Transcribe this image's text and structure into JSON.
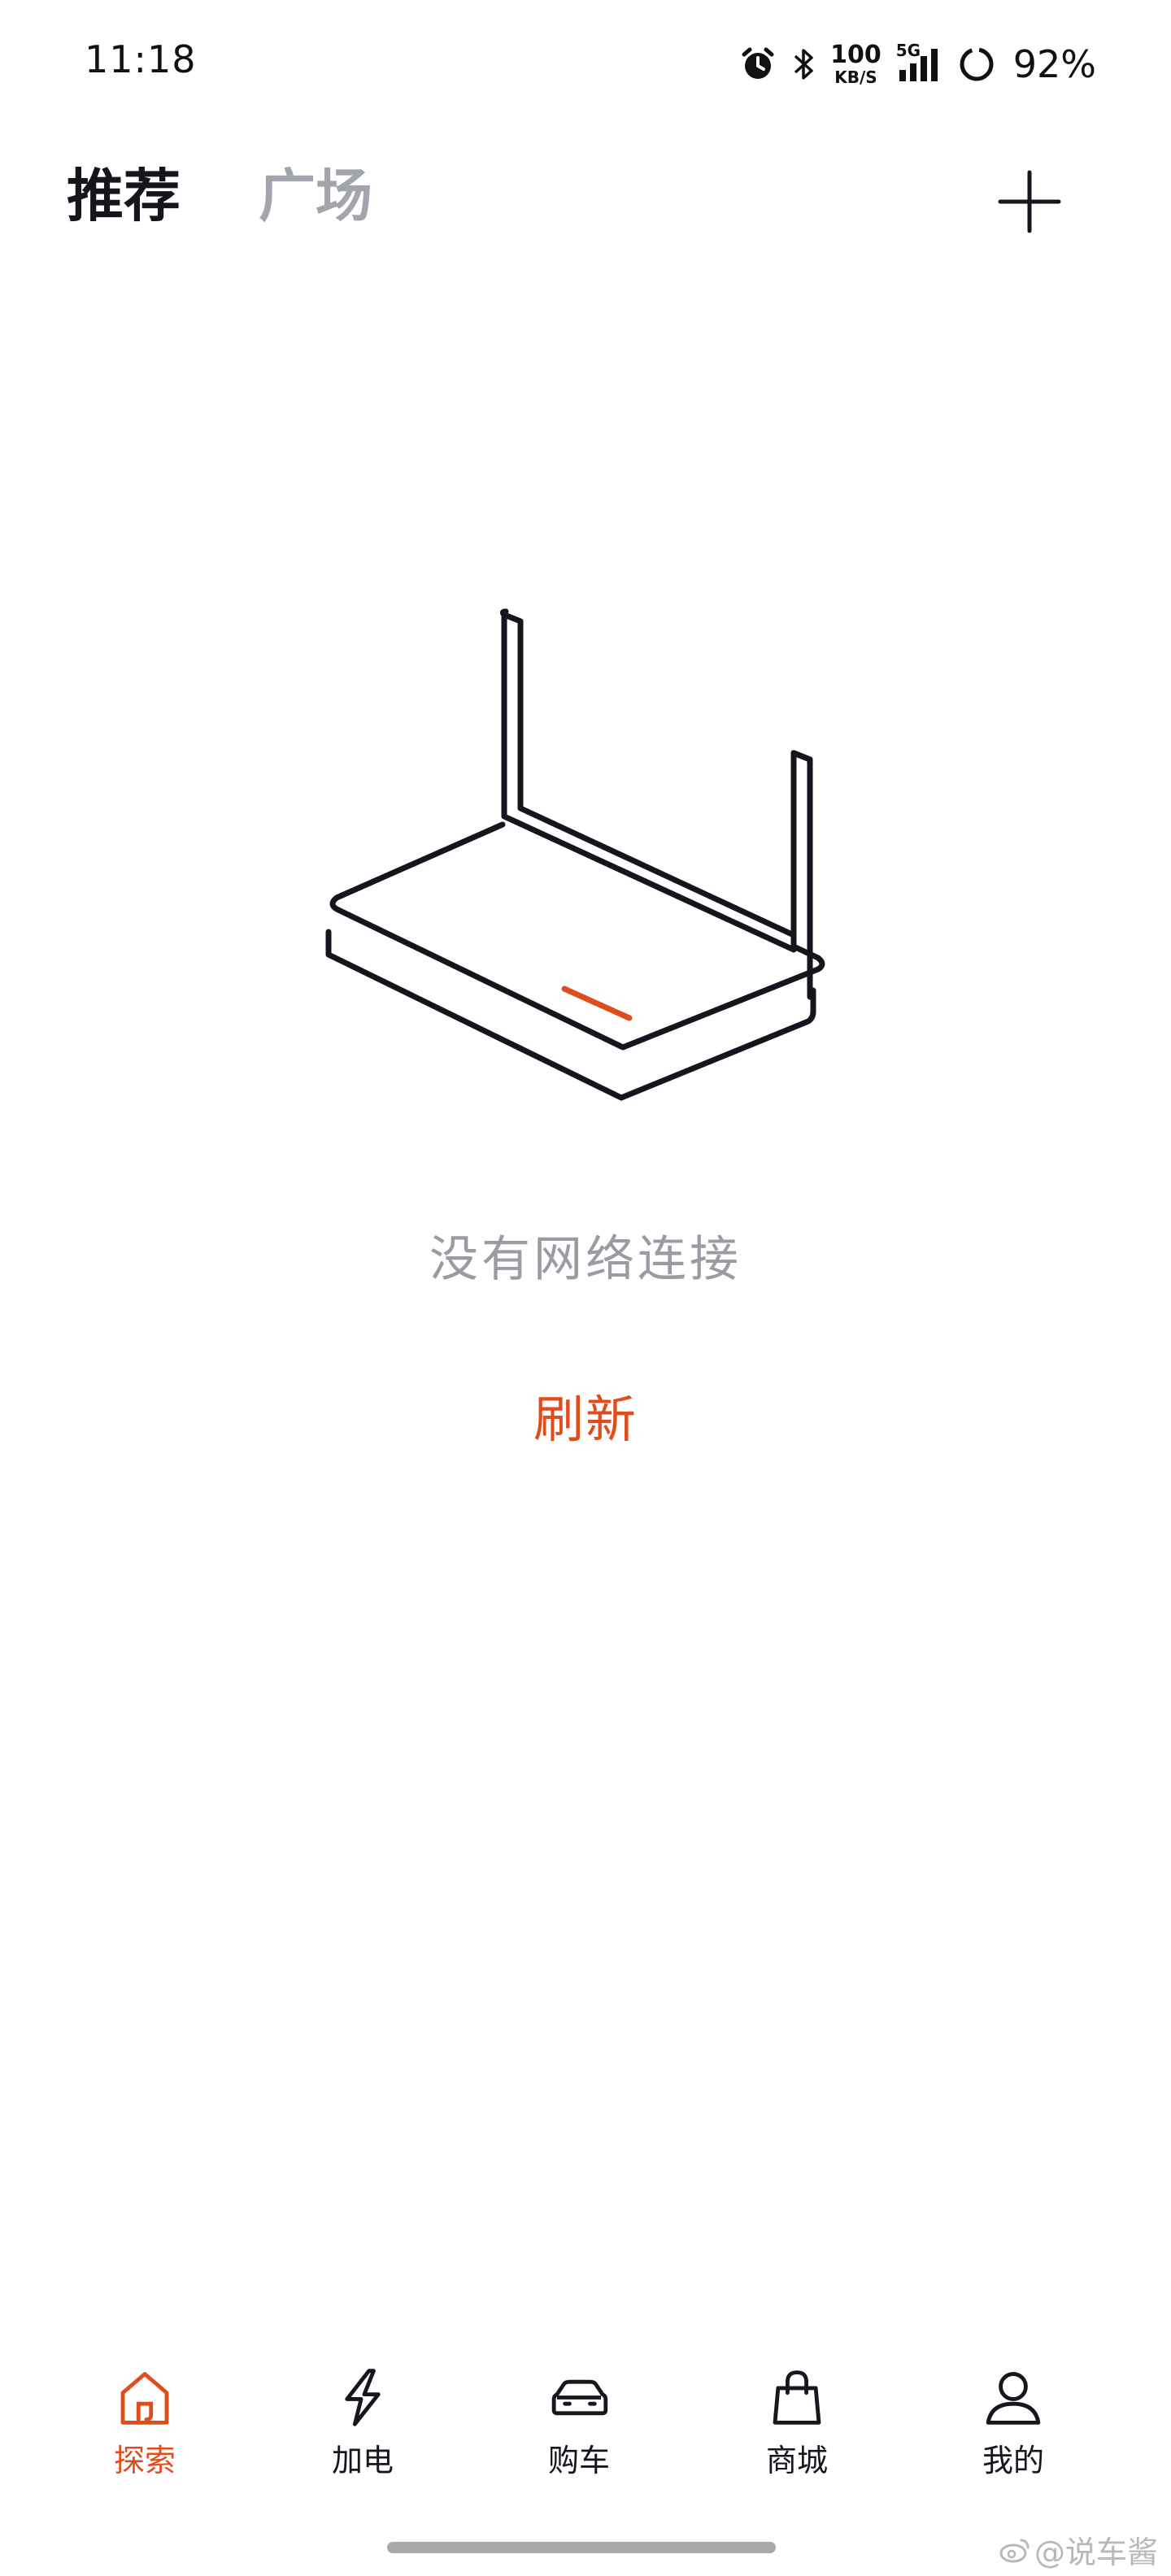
{
  "status_bar": {
    "time": "11:18",
    "net_speed_value": "100",
    "net_speed_unit": "KB/S",
    "signal_label": "5G",
    "battery_percent": "92%",
    "icons": [
      "alarm-icon",
      "bluetooth-icon",
      "signal-icon",
      "battery-ring-icon"
    ]
  },
  "header": {
    "tabs": [
      {
        "label": "推荐",
        "active": true
      },
      {
        "label": "广场",
        "active": false
      }
    ],
    "add_icon": "plus-icon"
  },
  "empty_state": {
    "illustration": "router-icon",
    "message": "没有网络连接",
    "refresh_label": "刷新"
  },
  "bottom_nav": {
    "items": [
      {
        "label": "探索",
        "icon": "home-icon",
        "active": true
      },
      {
        "label": "加电",
        "icon": "lightning-icon",
        "active": false
      },
      {
        "label": "购车",
        "icon": "car-icon",
        "active": false
      },
      {
        "label": "商城",
        "icon": "shopping-bag-icon",
        "active": false
      },
      {
        "label": "我的",
        "icon": "profile-icon",
        "active": false
      }
    ]
  },
  "watermark": {
    "text": "@说车酱"
  },
  "colors": {
    "accent": "#e04d1d",
    "text_primary": "#16161e",
    "text_secondary": "#9a9ca3",
    "tab_inactive": "#a3a5ad",
    "background": "#ffffff"
  }
}
